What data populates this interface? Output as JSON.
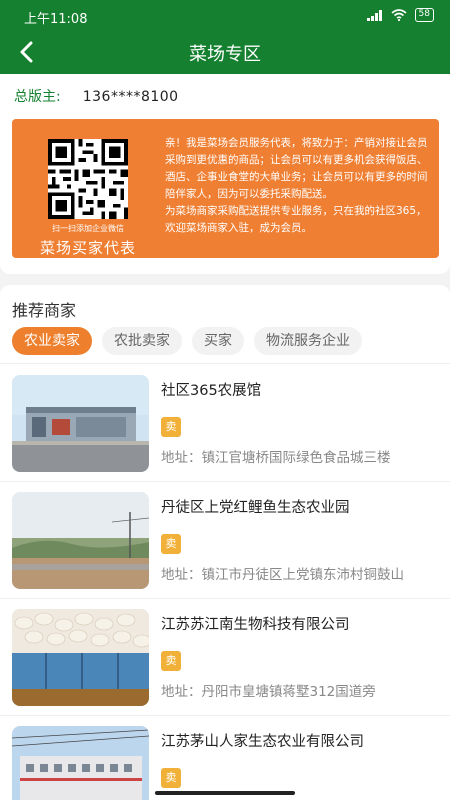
{
  "status_bar": {
    "time": "上午11:08",
    "battery": "58",
    "icons": [
      "signal-icon",
      "wifi-icon",
      "battery-icon"
    ]
  },
  "header": {
    "title": "菜场专区",
    "back_icon": "back-arrow-icon",
    "color": "#15802f"
  },
  "owner": {
    "label": "总版主:",
    "phone": "136****8100"
  },
  "banner": {
    "qr_caption": "扫一扫添加企业微信",
    "qr_title": "菜场买家代表",
    "paragraph1": "亲！我是菜场会员服务代表，将致力于：产销对接让会员采购到更优惠的商品；让会员可以有更多机会获得饭店、酒店、企事业食堂的大单业务；让会员可以有更多的时间陪伴家人，因为可以委托采购配送。",
    "paragraph2": "为菜场商家采购配送提供专业服务，只在我的社区365，欢迎菜场商家入驻，成为会员。",
    "color": "#ef7f33"
  },
  "section": {
    "title": "推荐商家",
    "tabs": [
      {
        "label": "农业卖家",
        "active": true
      },
      {
        "label": "农批卖家",
        "active": false
      },
      {
        "label": "买家",
        "active": false
      },
      {
        "label": "物流服务企业",
        "active": false
      }
    ]
  },
  "merchants": [
    {
      "name": "社区365农展馆",
      "tag": "卖",
      "address": "地址：镇江官塘桥国际绿色食品城三楼"
    },
    {
      "name": "丹徒区上党红鲤鱼生态农业园",
      "tag": "卖",
      "address": "地址：镇江市丹徒区上党镇东沛村铜鼓山"
    },
    {
      "name": "江苏苏江南生物科技有限公司",
      "tag": "卖",
      "address": "地址：丹阳市皇塘镇蒋墅312国道旁"
    },
    {
      "name": "江苏茅山人家生态农业有限公司",
      "tag": "卖",
      "address": ""
    }
  ],
  "accent": {
    "tab_active": "#ee7f2c",
    "tag": "#f1b037"
  }
}
